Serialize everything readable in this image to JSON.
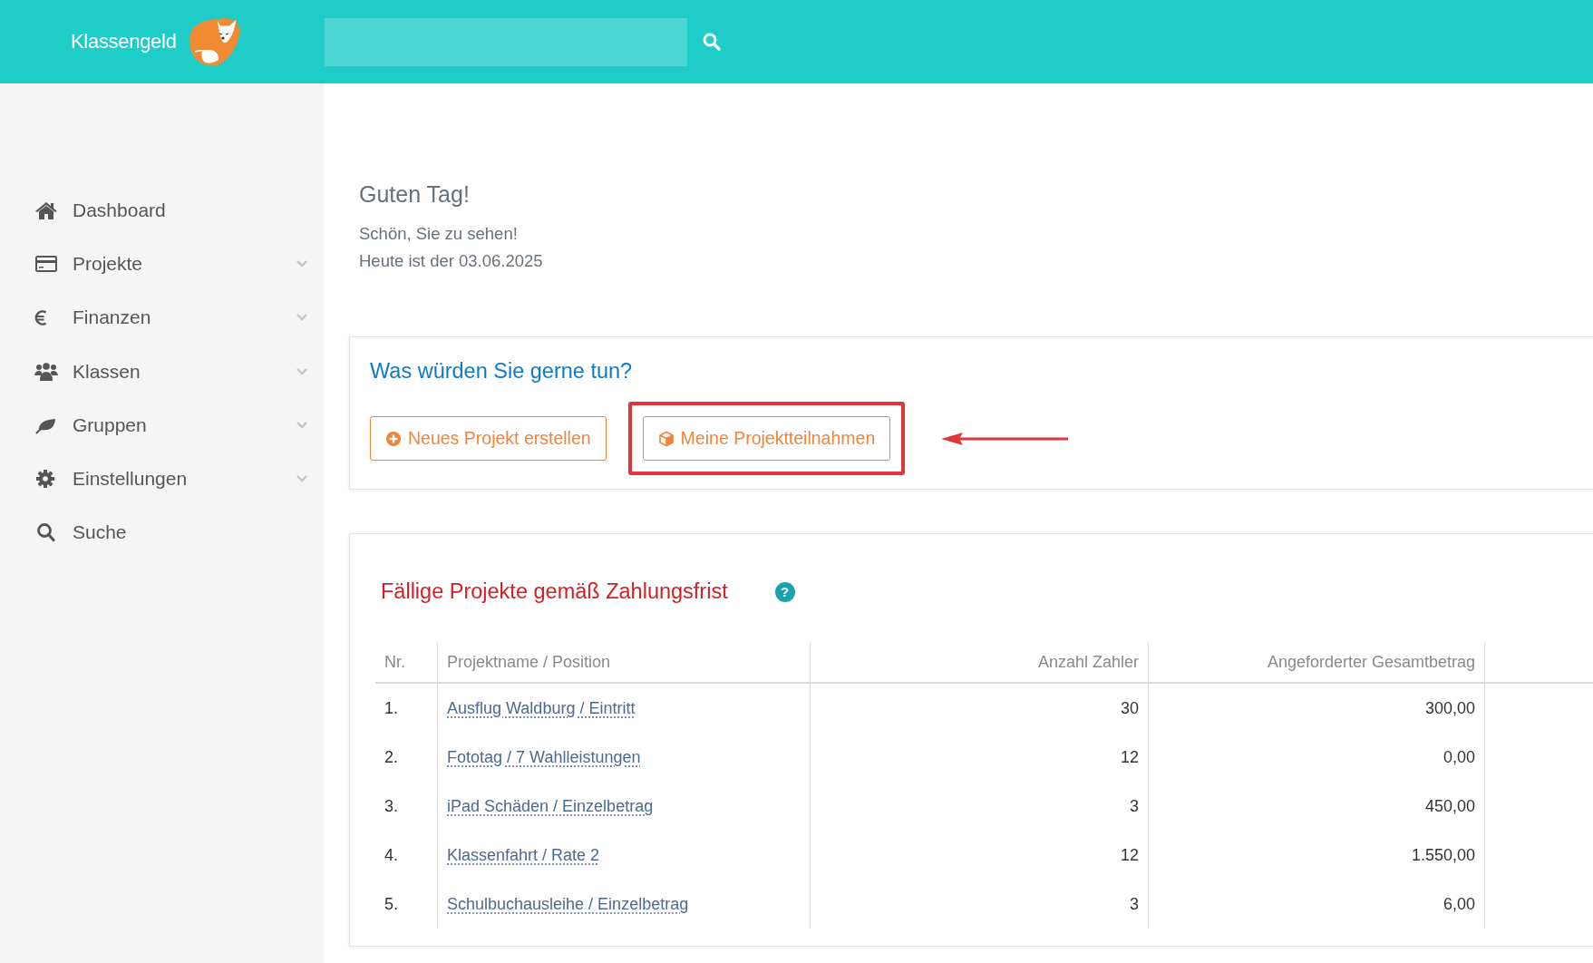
{
  "header": {
    "logo_text": "Klassengeld"
  },
  "sidebar": {
    "items": [
      {
        "label": "Dashboard",
        "expandable": false
      },
      {
        "label": "Projekte",
        "expandable": true
      },
      {
        "label": "Finanzen",
        "expandable": true
      },
      {
        "label": "Klassen",
        "expandable": true
      },
      {
        "label": "Gruppen",
        "expandable": true
      },
      {
        "label": "Einstellungen",
        "expandable": true
      },
      {
        "label": "Suche",
        "expandable": false
      }
    ]
  },
  "greeting": {
    "title": "Guten Tag!",
    "lines": [
      "Schön, Sie zu sehen!",
      "Heute ist der 03.06.2025"
    ]
  },
  "actions": {
    "title": "Was würden Sie gerne tun?",
    "buttons": [
      {
        "label": "Neues Projekt erstellen",
        "highlighted": false
      },
      {
        "label": "Meine Projektteilnahmen",
        "highlighted": true
      }
    ]
  },
  "due_projects": {
    "title": "Fällige Projekte gemäß Zahlungsfrist",
    "help_icon": "?",
    "table": {
      "columns": [
        "Nr.",
        "Projektname / Position",
        "Anzahl Zahler",
        "Angeforderter Gesamtbetrag"
      ],
      "rows": [
        [
          "1.",
          "Ausflug Waldburg / Eintritt",
          "30",
          "300,00"
        ],
        [
          "2.",
          "Fototag / 7 Wahlleistungen",
          "12",
          "0,00"
        ],
        [
          "3.",
          "iPad Schäden / Einzelbetrag",
          "3",
          "450,00"
        ],
        [
          "4.",
          "Klassenfahrt / Rate 2",
          "12",
          "1.550,00"
        ],
        [
          "5.",
          "Schulbuchausleihe / Einzelbetrag",
          "3",
          "6,00"
        ]
      ]
    }
  }
}
